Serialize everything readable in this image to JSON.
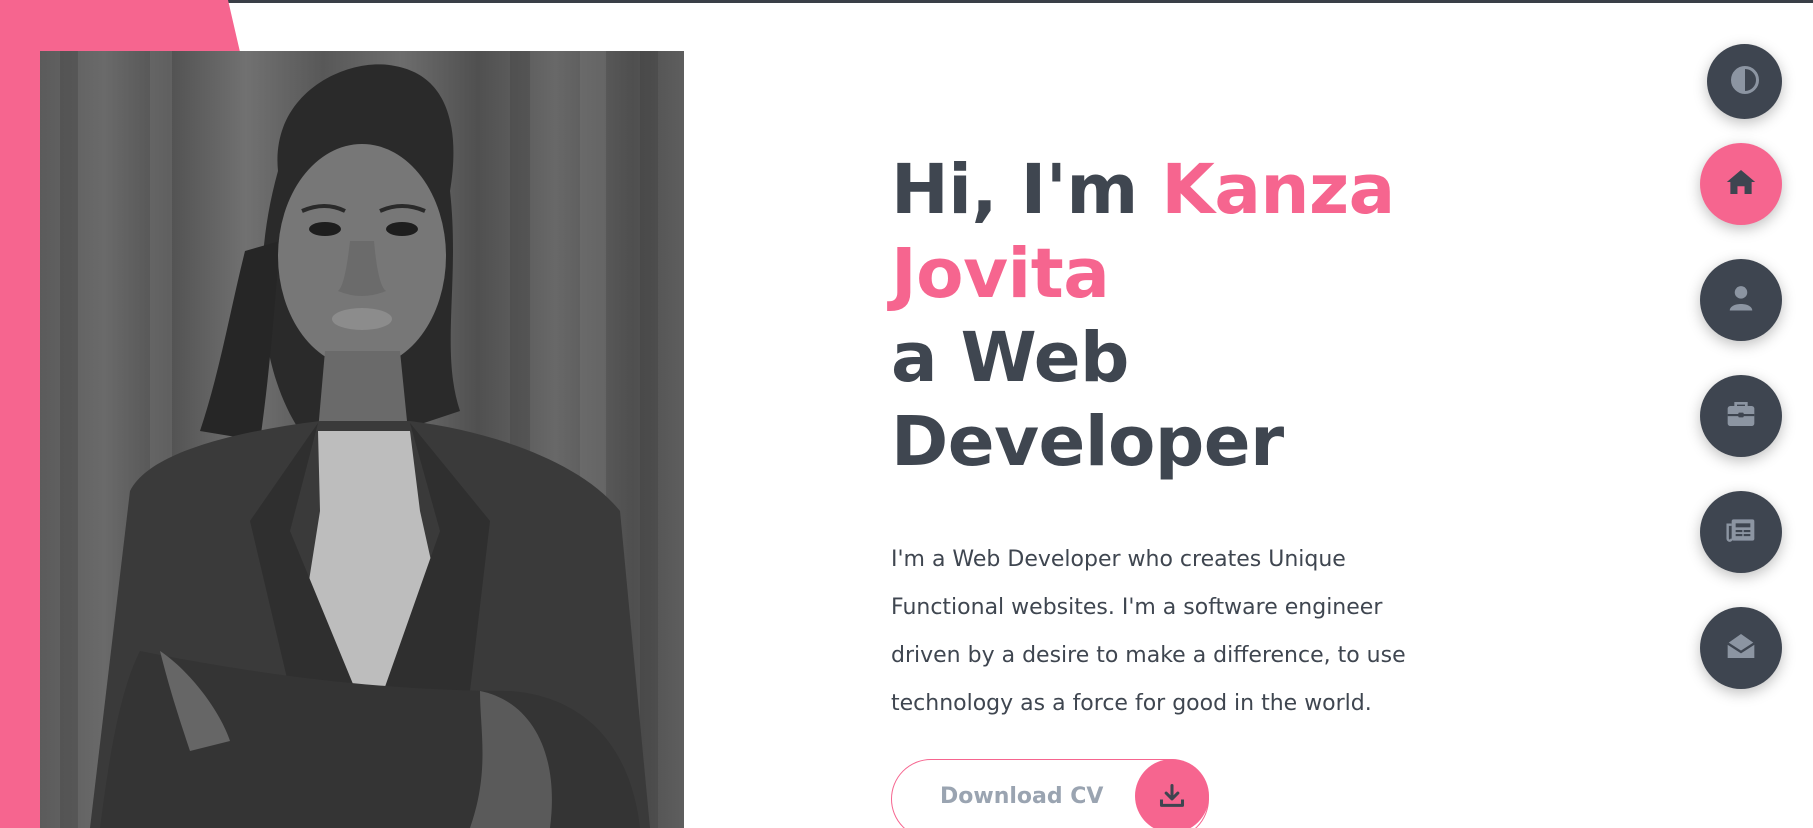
{
  "hero": {
    "greeting": "Hi, I'm ",
    "first_name": "Kanza",
    "last_name": "Jovita",
    "role_line1": "a Web",
    "role_line2": "Developer",
    "bio_lines": [
      "I'm a Web Developer who creates Unique",
      "Functional websites. I'm a software engineer",
      "driven by a desire to make a difference, to use",
      "technology as a force for good in the world."
    ],
    "cv_button_label": "Download CV",
    "cv_button_icon": "download-icon"
  },
  "theme_toggle": {
    "icon": "contrast-icon"
  },
  "nav": [
    {
      "id": "home",
      "icon": "home-icon",
      "active": true
    },
    {
      "id": "about",
      "icon": "user-icon",
      "active": false
    },
    {
      "id": "portfolio",
      "icon": "briefcase-icon",
      "active": false
    },
    {
      "id": "blog",
      "icon": "newspaper-icon",
      "active": false
    },
    {
      "id": "contact",
      "icon": "envelope-open-icon",
      "active": false
    }
  ],
  "colors": {
    "accent": "#f6658f",
    "dark": "#3e4550",
    "text": "#3f4650",
    "muted_label": "#9aa4b1"
  }
}
